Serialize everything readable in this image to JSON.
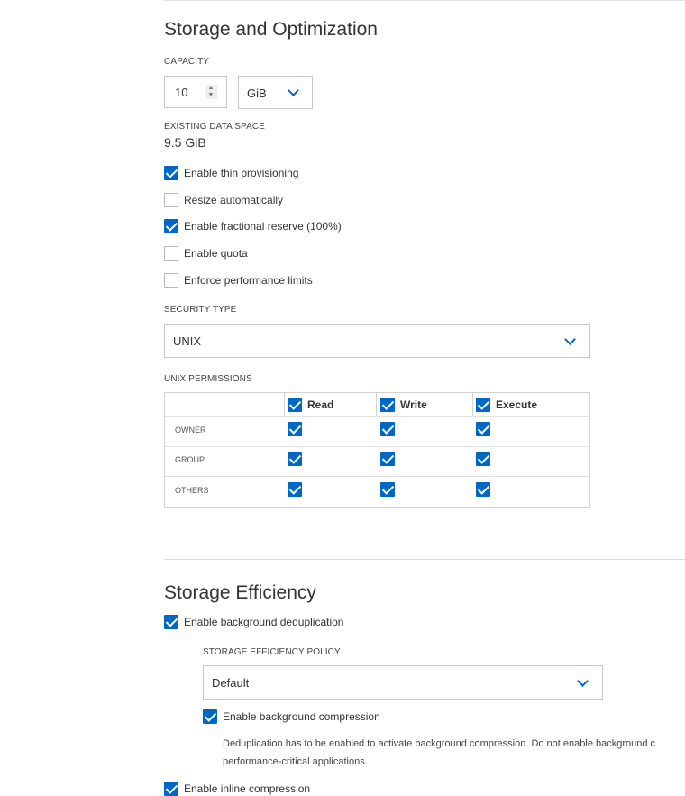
{
  "storage": {
    "title": "Storage and Optimization",
    "capacity_label": "CAPACITY",
    "capacity_value": "10",
    "capacity_unit": "GiB",
    "existing_label": "EXISTING DATA SPACE",
    "existing_value": "9.5 GiB",
    "options": [
      {
        "label": "Enable thin provisioning",
        "checked": true
      },
      {
        "label": "Resize automatically",
        "checked": false
      },
      {
        "label": "Enable fractional reserve (100%)",
        "checked": true
      },
      {
        "label": "Enable quota",
        "checked": false
      },
      {
        "label": "Enforce performance limits",
        "checked": false
      }
    ],
    "security_type_label": "SECURITY TYPE",
    "security_type_value": "UNIX",
    "unix_permissions_label": "UNIX PERMISSIONS",
    "permissions": {
      "columns": [
        "Read",
        "Write",
        "Execute"
      ],
      "rows": [
        {
          "name": "OWNER",
          "values": [
            true,
            true,
            true
          ]
        },
        {
          "name": "GROUP",
          "values": [
            true,
            true,
            true
          ]
        },
        {
          "name": "OTHERS",
          "values": [
            true,
            true,
            true
          ]
        }
      ]
    }
  },
  "efficiency": {
    "title": "Storage Efficiency",
    "dedup_label": "Enable background deduplication",
    "dedup_checked": true,
    "policy_label": "STORAGE EFFICIENCY POLICY",
    "policy_value": "Default",
    "compression_label": "Enable background compression",
    "compression_checked": true,
    "compression_note_line1": "Deduplication has to be enabled to activate background compression. Do not enable background c",
    "compression_note_line2": "performance-critical applications.",
    "inline_label": "Enable inline compression",
    "inline_checked": true
  },
  "colors": {
    "accent": "#0067c5",
    "border": "#c8c8c8"
  }
}
